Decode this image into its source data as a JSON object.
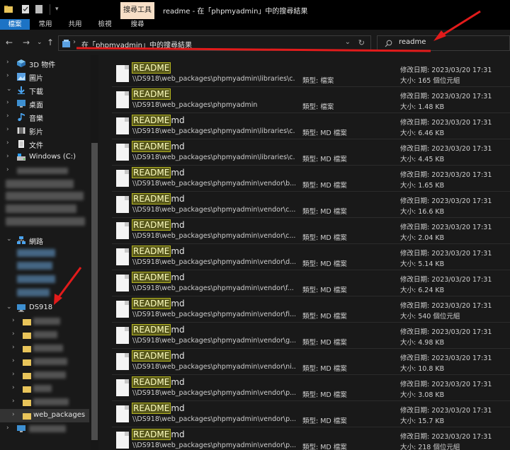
{
  "titlebar": {
    "context_tab": "搜尋工具",
    "window_title": "readme - 在「phpmyadmin」中的搜尋結果"
  },
  "ribbon": {
    "tabs": [
      {
        "label": "檔案"
      },
      {
        "label": "常用"
      },
      {
        "label": "共用"
      },
      {
        "label": "檢視"
      },
      {
        "label": "搜尋"
      }
    ]
  },
  "address": {
    "path": "在「phpmyadmin」中的搜尋結果"
  },
  "search": {
    "value": "readme"
  },
  "sidebar": {
    "items": [
      {
        "label": "3D 物件"
      },
      {
        "label": "圖片"
      },
      {
        "label": "下載"
      },
      {
        "label": "桌面"
      },
      {
        "label": "音樂"
      },
      {
        "label": "影片"
      },
      {
        "label": "文件"
      },
      {
        "label": "Windows (C:)"
      }
    ],
    "network": "網路",
    "ds918": "DS918",
    "web_packages": "web_packages"
  },
  "results": [
    {
      "name_hl": "README",
      "name_rest": "",
      "path": "\\\\DS918\\web_packages\\phpmyadmin\\libraries\\c...",
      "type": "類型: 檔案",
      "date": "修改日期: 2023/03/20 17:31",
      "size": "大小: 165 個位元組"
    },
    {
      "name_hl": "README",
      "name_rest": "",
      "path": "\\\\DS918\\web_packages\\phpmyadmin",
      "type": "類型: 檔案",
      "date": "修改日期: 2023/03/20 17:31",
      "size": "大小: 1.48 KB"
    },
    {
      "name_hl": "README",
      "name_rest": "md",
      "path": "\\\\DS918\\web_packages\\phpmyadmin\\libraries\\c...",
      "type": "類型: MD 檔案",
      "date": "修改日期: 2023/03/20 17:31",
      "size": "大小: 6.46 KB"
    },
    {
      "name_hl": "README",
      "name_rest": "md",
      "path": "\\\\DS918\\web_packages\\phpmyadmin\\libraries\\c...",
      "type": "類型: MD 檔案",
      "date": "修改日期: 2023/03/20 17:31",
      "size": "大小: 4.45 KB"
    },
    {
      "name_hl": "README",
      "name_rest": "md",
      "path": "\\\\DS918\\web_packages\\phpmyadmin\\vendor\\b...",
      "type": "類型: MD 檔案",
      "date": "修改日期: 2023/03/20 17:31",
      "size": "大小: 1.65 KB"
    },
    {
      "name_hl": "README",
      "name_rest": "md",
      "path": "\\\\DS918\\web_packages\\phpmyadmin\\vendor\\c...",
      "type": "類型: MD 檔案",
      "date": "修改日期: 2023/03/20 17:31",
      "size": "大小: 16.6 KB"
    },
    {
      "name_hl": "README",
      "name_rest": "md",
      "path": "\\\\DS918\\web_packages\\phpmyadmin\\vendor\\c...",
      "type": "類型: MD 檔案",
      "date": "修改日期: 2023/03/20 17:31",
      "size": "大小: 2.04 KB"
    },
    {
      "name_hl": "README",
      "name_rest": "md",
      "path": "\\\\DS918\\web_packages\\phpmyadmin\\vendor\\d...",
      "type": "類型: MD 檔案",
      "date": "修改日期: 2023/03/20 17:31",
      "size": "大小: 5.14 KB"
    },
    {
      "name_hl": "README",
      "name_rest": "md",
      "path": "\\\\DS918\\web_packages\\phpmyadmin\\vendor\\f...",
      "type": "類型: MD 檔案",
      "date": "修改日期: 2023/03/20 17:31",
      "size": "大小: 6.24 KB"
    },
    {
      "name_hl": "README",
      "name_rest": "md",
      "path": "\\\\DS918\\web_packages\\phpmyadmin\\vendor\\fi...",
      "type": "類型: MD 檔案",
      "date": "修改日期: 2023/03/20 17:31",
      "size": "大小: 540 個位元組"
    },
    {
      "name_hl": "README",
      "name_rest": "md",
      "path": "\\\\DS918\\web_packages\\phpmyadmin\\vendor\\g...",
      "type": "類型: MD 檔案",
      "date": "修改日期: 2023/03/20 17:31",
      "size": "大小: 4.98 KB"
    },
    {
      "name_hl": "README",
      "name_rest": "md",
      "path": "\\\\DS918\\web_packages\\phpmyadmin\\vendor\\ni...",
      "type": "類型: MD 檔案",
      "date": "修改日期: 2023/03/20 17:31",
      "size": "大小: 10.8 KB"
    },
    {
      "name_hl": "README",
      "name_rest": "md",
      "path": "\\\\DS918\\web_packages\\phpmyadmin\\vendor\\p...",
      "type": "類型: MD 檔案",
      "date": "修改日期: 2023/03/20 17:31",
      "size": "大小: 3.08 KB"
    },
    {
      "name_hl": "README",
      "name_rest": "md",
      "path": "\\\\DS918\\web_packages\\phpmyadmin\\vendor\\p...",
      "type": "類型: MD 檔案",
      "date": "修改日期: 2023/03/20 17:31",
      "size": "大小: 15.7 KB"
    },
    {
      "name_hl": "README",
      "name_rest": "md",
      "path": "\\\\DS918\\web_packages\\phpmyadmin\\vendor\\p...",
      "type": "類型: MD 檔案",
      "date": "修改日期: 2023/03/20 17:31",
      "size": "大小: 218 個位元組"
    }
  ],
  "colors": {
    "accent": "#1c73c5",
    "highlight": "#b5b51f",
    "annotation": "#e21b1b",
    "context_tab": "#f7dfc7"
  }
}
